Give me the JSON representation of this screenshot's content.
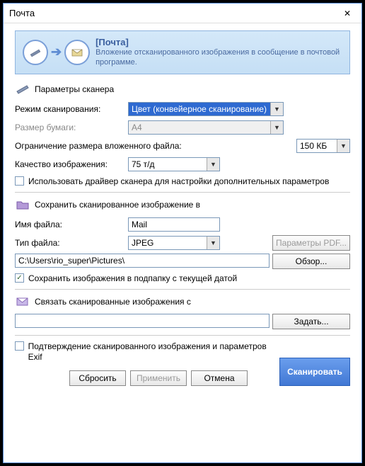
{
  "window": {
    "title": "Почта"
  },
  "banner": {
    "title": "[Почта]",
    "desc": "Вложение отсканированного изображения в сообщение в почтовой программе."
  },
  "scanner": {
    "section": "Параметры сканера",
    "mode_label": "Режим сканирования:",
    "mode_value": "Цвет (конвейерное сканирование)",
    "paper_label": "Размер бумаги:",
    "paper_value": "A4",
    "limit_label": "Ограничение размера вложенного файла:",
    "limit_value": "150 КБ",
    "quality_label": "Качество изображения:",
    "quality_value": "75 т/д",
    "use_driver": "Использовать драйвер сканера для настройки дополнительных параметров"
  },
  "save": {
    "section": "Сохранить сканированное изображение в",
    "filename_label": "Имя файла:",
    "filename_value": "Mail",
    "filetype_label": "Тип файла:",
    "filetype_value": "JPEG",
    "pdf_btn": "Параметры PDF...",
    "path": "C:\\Users\\rio_super\\Pictures\\",
    "browse_btn": "Обзор...",
    "subfolder": "Сохранить изображения в подпапку с текущей датой"
  },
  "link": {
    "section": "Связать сканированные изображения с",
    "value": "",
    "set_btn": "Задать..."
  },
  "bottom": {
    "confirm": "Подтверждение сканированного изображения и параметров Exif",
    "reset_btn": "Сбросить",
    "apply_btn": "Применить",
    "cancel_btn": "Отмена",
    "scan_btn": "Сканировать"
  }
}
